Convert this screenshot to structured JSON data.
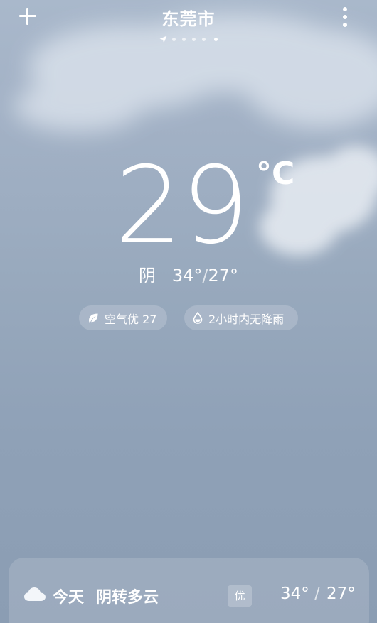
{
  "header": {
    "city": "东莞市",
    "page_count": 5,
    "active_page": 5
  },
  "current": {
    "temperature": "29",
    "unit": "°C",
    "condition": "阴",
    "high": "34°",
    "separator": "/",
    "low": "27°"
  },
  "chips": {
    "aqi": "空气优 27",
    "rain": "2小时内无降雨"
  },
  "today": {
    "label": "今天",
    "description": "阴转多云",
    "aqi_badge": "优",
    "high": "34°",
    "separator": "/",
    "low": "27°"
  },
  "icons": {
    "add": "plus-icon",
    "more": "more-vertical-icon",
    "location": "location-arrow-icon",
    "aqi": "leaf-icon",
    "rain": "water-drop-icon",
    "today": "cloud-icon"
  },
  "colors": {
    "sky_top": "#a9b8cb",
    "sky_bottom": "#8b9db3",
    "text": "#ffffff"
  }
}
